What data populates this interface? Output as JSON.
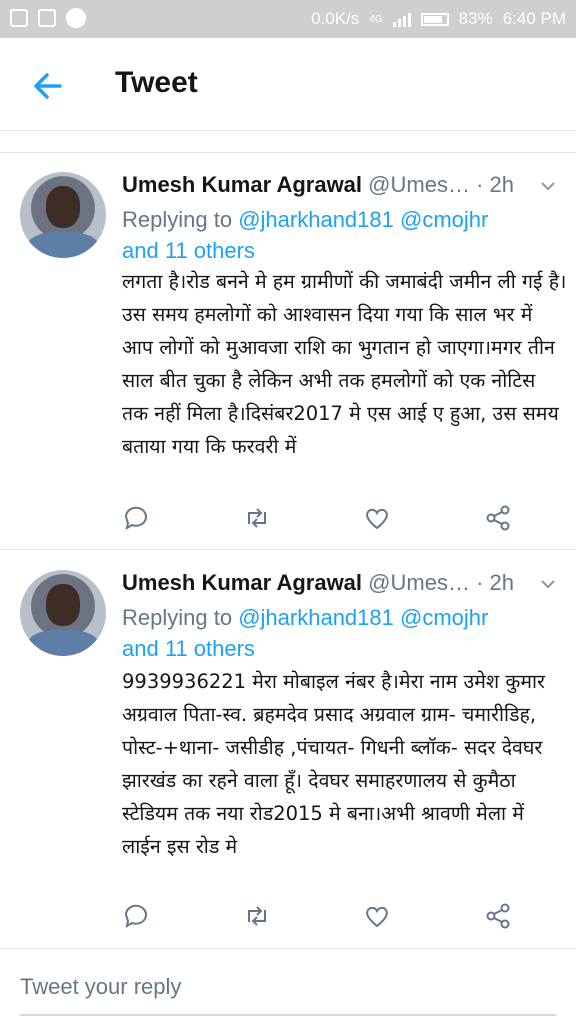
{
  "status_bar": {
    "speed": "0.0K/s",
    "network": "4G",
    "battery": "83%",
    "time": "6:40 PM"
  },
  "header": {
    "title": "Tweet"
  },
  "tweets": [
    {
      "name": "Umesh Kumar Agrawal",
      "handle": "@Umes…",
      "time": "· 2h",
      "replying_prefix": "Replying to",
      "mention_1": "@jharkhand181",
      "mention_2": "@cmojhr",
      "and_others": "and 11 others",
      "text": "लगता है।रोड बनने मे हम ग्रामीणों की जमाबंदी जमीन ली गई है।उस समय हमलोगों को आश्वासन दिया गया कि साल भर में आप लोगों को मुआवजा राशि का भुगतान हो जाएगा।मगर तीन साल बीत चुका है लेकिन अभी तक हमलोगों को एक नोटिस तक नहीं मिला है।दिसंबर2017 मे एस आई ए हुआ, उस समय बताया गया कि फरवरी में"
    },
    {
      "name": "Umesh Kumar Agrawal",
      "handle": "@Umes…",
      "time": "· 2h",
      "replying_prefix": "Replying to",
      "mention_1": "@jharkhand181",
      "mention_2": "@cmojhr",
      "and_others": "and 11 others",
      "text": "9939936221 मेरा मोबाइल नंबर है।मेरा नाम उमेश कुमार अग्रवाल पिता-स्व. ब्रहमदेव प्रसाद अग्रवाल ग्राम- चमारीडिह, पोस्ट-+थाना- जसीडीह ,पंचायत- गिधनी ब्लॉक- सदर देवघर\nझारखंड का रहने वाला हूँ। देवघर समाहरणालय से कुमैठा स्टेडियम तक नया रोड2015 मे बना।अभी श्रावणी मेला में लाईन इस रोड मे"
    }
  ],
  "reply": {
    "placeholder": "Tweet your reply"
  },
  "colors": {
    "accent": "#1da1f2",
    "muted": "#657786",
    "text": "#14171a"
  }
}
